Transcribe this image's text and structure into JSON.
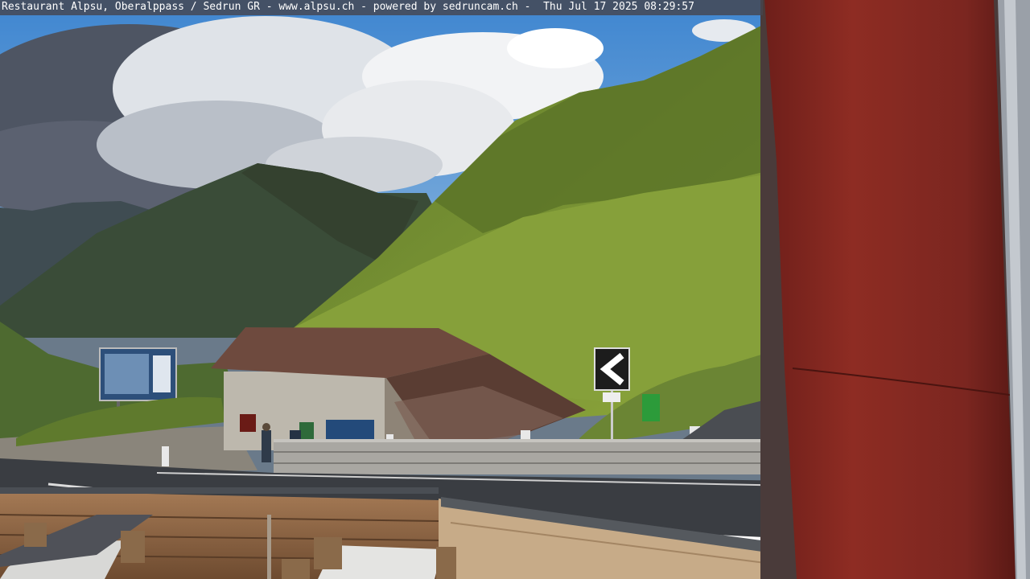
{
  "overlay": {
    "caption": "Restaurant Alpsu, Oberalppass / Sedrun GR - www.alpsu.ch - powered by sedruncam.ch -  Thu Jul 17 2025 08:29:57"
  },
  "colors": {
    "sky": "#5fa0d8",
    "meadow": "#7d9a33",
    "post_red": "#8a2a22",
    "road": "#3a3d42",
    "roof_rust": "#6e4a3e"
  },
  "icons": {
    "road_sign": "chevron-left-icon"
  }
}
